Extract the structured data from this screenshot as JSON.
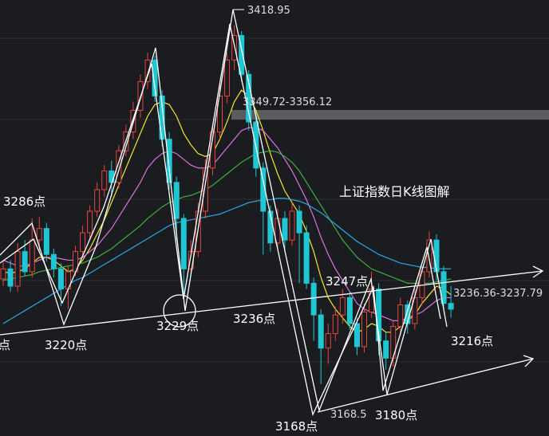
{
  "chart_data": {
    "type": "candlestick",
    "title": "上证指数日K线图解",
    "ylim": [
      3150,
      3430
    ],
    "grid": true,
    "price_tags": {
      "high": "3418.95",
      "zone_upper": "3349.72-3356.12",
      "zone_lower": "3236.36-3237.79",
      "low": "3168.5"
    },
    "point_labels": [
      "3286点",
      "3220点",
      "3229点",
      "3236点",
      "3247点",
      "3168点",
      "3180点",
      "3216点",
      "点"
    ],
    "candles": [
      {
        "o": 3243,
        "c": 3250,
        "h": 3255,
        "l": 3238
      },
      {
        "o": 3250,
        "c": 3238,
        "h": 3256,
        "l": 3234
      },
      {
        "o": 3238,
        "c": 3262,
        "h": 3268,
        "l": 3234
      },
      {
        "o": 3262,
        "c": 3248,
        "h": 3270,
        "l": 3245
      },
      {
        "o": 3248,
        "c": 3270,
        "h": 3285,
        "l": 3244
      },
      {
        "o": 3270,
        "c": 3278,
        "h": 3286,
        "l": 3262
      },
      {
        "o": 3278,
        "c": 3260,
        "h": 3282,
        "l": 3255
      },
      {
        "o": 3260,
        "c": 3250,
        "h": 3264,
        "l": 3244
      },
      {
        "o": 3250,
        "c": 3236,
        "h": 3254,
        "l": 3224
      },
      {
        "o": 3236,
        "c": 3248,
        "h": 3252,
        "l": 3222
      },
      {
        "o": 3248,
        "c": 3262,
        "h": 3266,
        "l": 3245
      },
      {
        "o": 3262,
        "c": 3275,
        "h": 3280,
        "l": 3258
      },
      {
        "o": 3275,
        "c": 3290,
        "h": 3294,
        "l": 3270
      },
      {
        "o": 3290,
        "c": 3305,
        "h": 3310,
        "l": 3286
      },
      {
        "o": 3305,
        "c": 3318,
        "h": 3322,
        "l": 3300
      },
      {
        "o": 3318,
        "c": 3310,
        "h": 3325,
        "l": 3300
      },
      {
        "o": 3310,
        "c": 3332,
        "h": 3336,
        "l": 3306
      },
      {
        "o": 3332,
        "c": 3345,
        "h": 3350,
        "l": 3328
      },
      {
        "o": 3345,
        "c": 3360,
        "h": 3366,
        "l": 3340
      },
      {
        "o": 3360,
        "c": 3380,
        "h": 3385,
        "l": 3355
      },
      {
        "o": 3380,
        "c": 3395,
        "h": 3400,
        "l": 3375
      },
      {
        "o": 3395,
        "c": 3370,
        "h": 3398,
        "l": 3366
      },
      {
        "o": 3370,
        "c": 3340,
        "h": 3374,
        "l": 3335
      },
      {
        "o": 3340,
        "c": 3310,
        "h": 3345,
        "l": 3305
      },
      {
        "o": 3310,
        "c": 3285,
        "h": 3314,
        "l": 3270
      },
      {
        "o": 3285,
        "c": 3250,
        "h": 3288,
        "l": 3232
      },
      {
        "o": 3250,
        "c": 3262,
        "h": 3270,
        "l": 3246
      },
      {
        "o": 3262,
        "c": 3290,
        "h": 3296,
        "l": 3258
      },
      {
        "o": 3290,
        "c": 3320,
        "h": 3326,
        "l": 3285
      },
      {
        "o": 3320,
        "c": 3345,
        "h": 3350,
        "l": 3315
      },
      {
        "o": 3345,
        "c": 3370,
        "h": 3378,
        "l": 3340
      },
      {
        "o": 3370,
        "c": 3395,
        "h": 3400,
        "l": 3365
      },
      {
        "o": 3395,
        "c": 3412,
        "h": 3419,
        "l": 3388
      },
      {
        "o": 3412,
        "c": 3385,
        "h": 3415,
        "l": 3380
      },
      {
        "o": 3385,
        "c": 3352,
        "h": 3388,
        "l": 3346
      },
      {
        "o": 3352,
        "c": 3320,
        "h": 3356,
        "l": 3314
      },
      {
        "o": 3320,
        "c": 3290,
        "h": 3324,
        "l": 3260
      },
      {
        "o": 3290,
        "c": 3268,
        "h": 3294,
        "l": 3262
      },
      {
        "o": 3268,
        "c": 3285,
        "h": 3292,
        "l": 3264
      },
      {
        "o": 3285,
        "c": 3270,
        "h": 3290,
        "l": 3262
      },
      {
        "o": 3270,
        "c": 3290,
        "h": 3296,
        "l": 3266
      },
      {
        "o": 3290,
        "c": 3275,
        "h": 3294,
        "l": 3240
      },
      {
        "o": 3275,
        "c": 3240,
        "h": 3280,
        "l": 3236
      },
      {
        "o": 3240,
        "c": 3218,
        "h": 3244,
        "l": 3200
      },
      {
        "o": 3218,
        "c": 3195,
        "h": 3222,
        "l": 3170
      },
      {
        "o": 3195,
        "c": 3205,
        "h": 3212,
        "l": 3184
      },
      {
        "o": 3205,
        "c": 3218,
        "h": 3224,
        "l": 3200
      },
      {
        "o": 3218,
        "c": 3230,
        "h": 3236,
        "l": 3212
      },
      {
        "o": 3230,
        "c": 3212,
        "h": 3234,
        "l": 3208
      },
      {
        "o": 3212,
        "c": 3196,
        "h": 3216,
        "l": 3190
      },
      {
        "o": 3196,
        "c": 3220,
        "h": 3226,
        "l": 3192
      },
      {
        "o": 3220,
        "c": 3236,
        "h": 3248,
        "l": 3216
      },
      {
        "o": 3236,
        "c": 3200,
        "h": 3240,
        "l": 3190
      },
      {
        "o": 3200,
        "c": 3188,
        "h": 3206,
        "l": 3180
      },
      {
        "o": 3188,
        "c": 3210,
        "h": 3214,
        "l": 3182
      },
      {
        "o": 3210,
        "c": 3225,
        "h": 3230,
        "l": 3204
      },
      {
        "o": 3225,
        "c": 3212,
        "h": 3228,
        "l": 3205
      },
      {
        "o": 3212,
        "c": 3230,
        "h": 3236,
        "l": 3208
      },
      {
        "o": 3230,
        "c": 3248,
        "h": 3252,
        "l": 3225
      },
      {
        "o": 3248,
        "c": 3270,
        "h": 3276,
        "l": 3244
      },
      {
        "o": 3270,
        "c": 3248,
        "h": 3274,
        "l": 3242
      },
      {
        "o": 3248,
        "c": 3226,
        "h": 3252,
        "l": 3222
      },
      {
        "o": 3226,
        "c": 3222,
        "h": 3238,
        "l": 3216
      }
    ],
    "moving_averages": [
      {
        "color": "#f5e62a",
        "values": [
          3248,
          3247,
          3248,
          3250,
          3254,
          3258,
          3258,
          3256,
          3252,
          3248,
          3250,
          3256,
          3264,
          3274,
          3284,
          3296,
          3308,
          3320,
          3332,
          3344,
          3356,
          3364,
          3366,
          3364,
          3356,
          3344,
          3336,
          3330,
          3328,
          3330,
          3340,
          3352,
          3366,
          3374,
          3370,
          3360,
          3346,
          3330,
          3316,
          3304,
          3296,
          3288,
          3276,
          3262,
          3244,
          3230,
          3222,
          3216,
          3210,
          3206,
          3208,
          3212,
          3210,
          3206,
          3206,
          3210,
          3214,
          3218,
          3226,
          3232,
          3238,
          3236,
          3232
        ]
      },
      {
        "color": "#e070e0",
        "values": [
          3256,
          3254,
          3252,
          3252,
          3254,
          3256,
          3258,
          3258,
          3257,
          3256,
          3256,
          3258,
          3262,
          3266,
          3272,
          3278,
          3286,
          3294,
          3302,
          3310,
          3320,
          3326,
          3330,
          3332,
          3330,
          3326,
          3322,
          3320,
          3320,
          3322,
          3328,
          3334,
          3340,
          3346,
          3348,
          3348,
          3346,
          3340,
          3334,
          3326,
          3318,
          3308,
          3298,
          3286,
          3272,
          3260,
          3250,
          3242,
          3234,
          3226,
          3222,
          3220,
          3218,
          3216,
          3214,
          3214,
          3216,
          3218,
          3220,
          3224,
          3228,
          3230,
          3230
        ]
      },
      {
        "color": "#3cb043",
        "values": [
          3242,
          3243,
          3244,
          3245,
          3246,
          3248,
          3249,
          3250,
          3251,
          3252,
          3253,
          3254,
          3256,
          3258,
          3261,
          3264,
          3268,
          3272,
          3276,
          3280,
          3285,
          3289,
          3293,
          3296,
          3298,
          3300,
          3301,
          3303,
          3305,
          3308,
          3312,
          3316,
          3320,
          3324,
          3327,
          3330,
          3331,
          3332,
          3331,
          3328,
          3324,
          3318,
          3310,
          3302,
          3294,
          3286,
          3278,
          3270,
          3264,
          3258,
          3254,
          3250,
          3248,
          3246,
          3244,
          3242,
          3240,
          3240,
          3240,
          3240,
          3241,
          3242,
          3243
        ]
      },
      {
        "color": "#29a8e8",
        "values": [
          3212,
          3215,
          3218,
          3221,
          3224,
          3227,
          3230,
          3233,
          3236,
          3239,
          3242,
          3244,
          3247,
          3250,
          3253,
          3256,
          3259,
          3262,
          3265,
          3268,
          3271,
          3274,
          3277,
          3280,
          3282,
          3283,
          3284,
          3285,
          3286,
          3287,
          3288,
          3290,
          3292,
          3294,
          3296,
          3297,
          3298,
          3298,
          3299,
          3299,
          3298,
          3297,
          3295,
          3292,
          3289,
          3285,
          3281,
          3277,
          3273,
          3269,
          3266,
          3263,
          3260,
          3258,
          3256,
          3254,
          3253,
          3252,
          3251,
          3251,
          3250,
          3250,
          3250
        ]
      }
    ]
  }
}
